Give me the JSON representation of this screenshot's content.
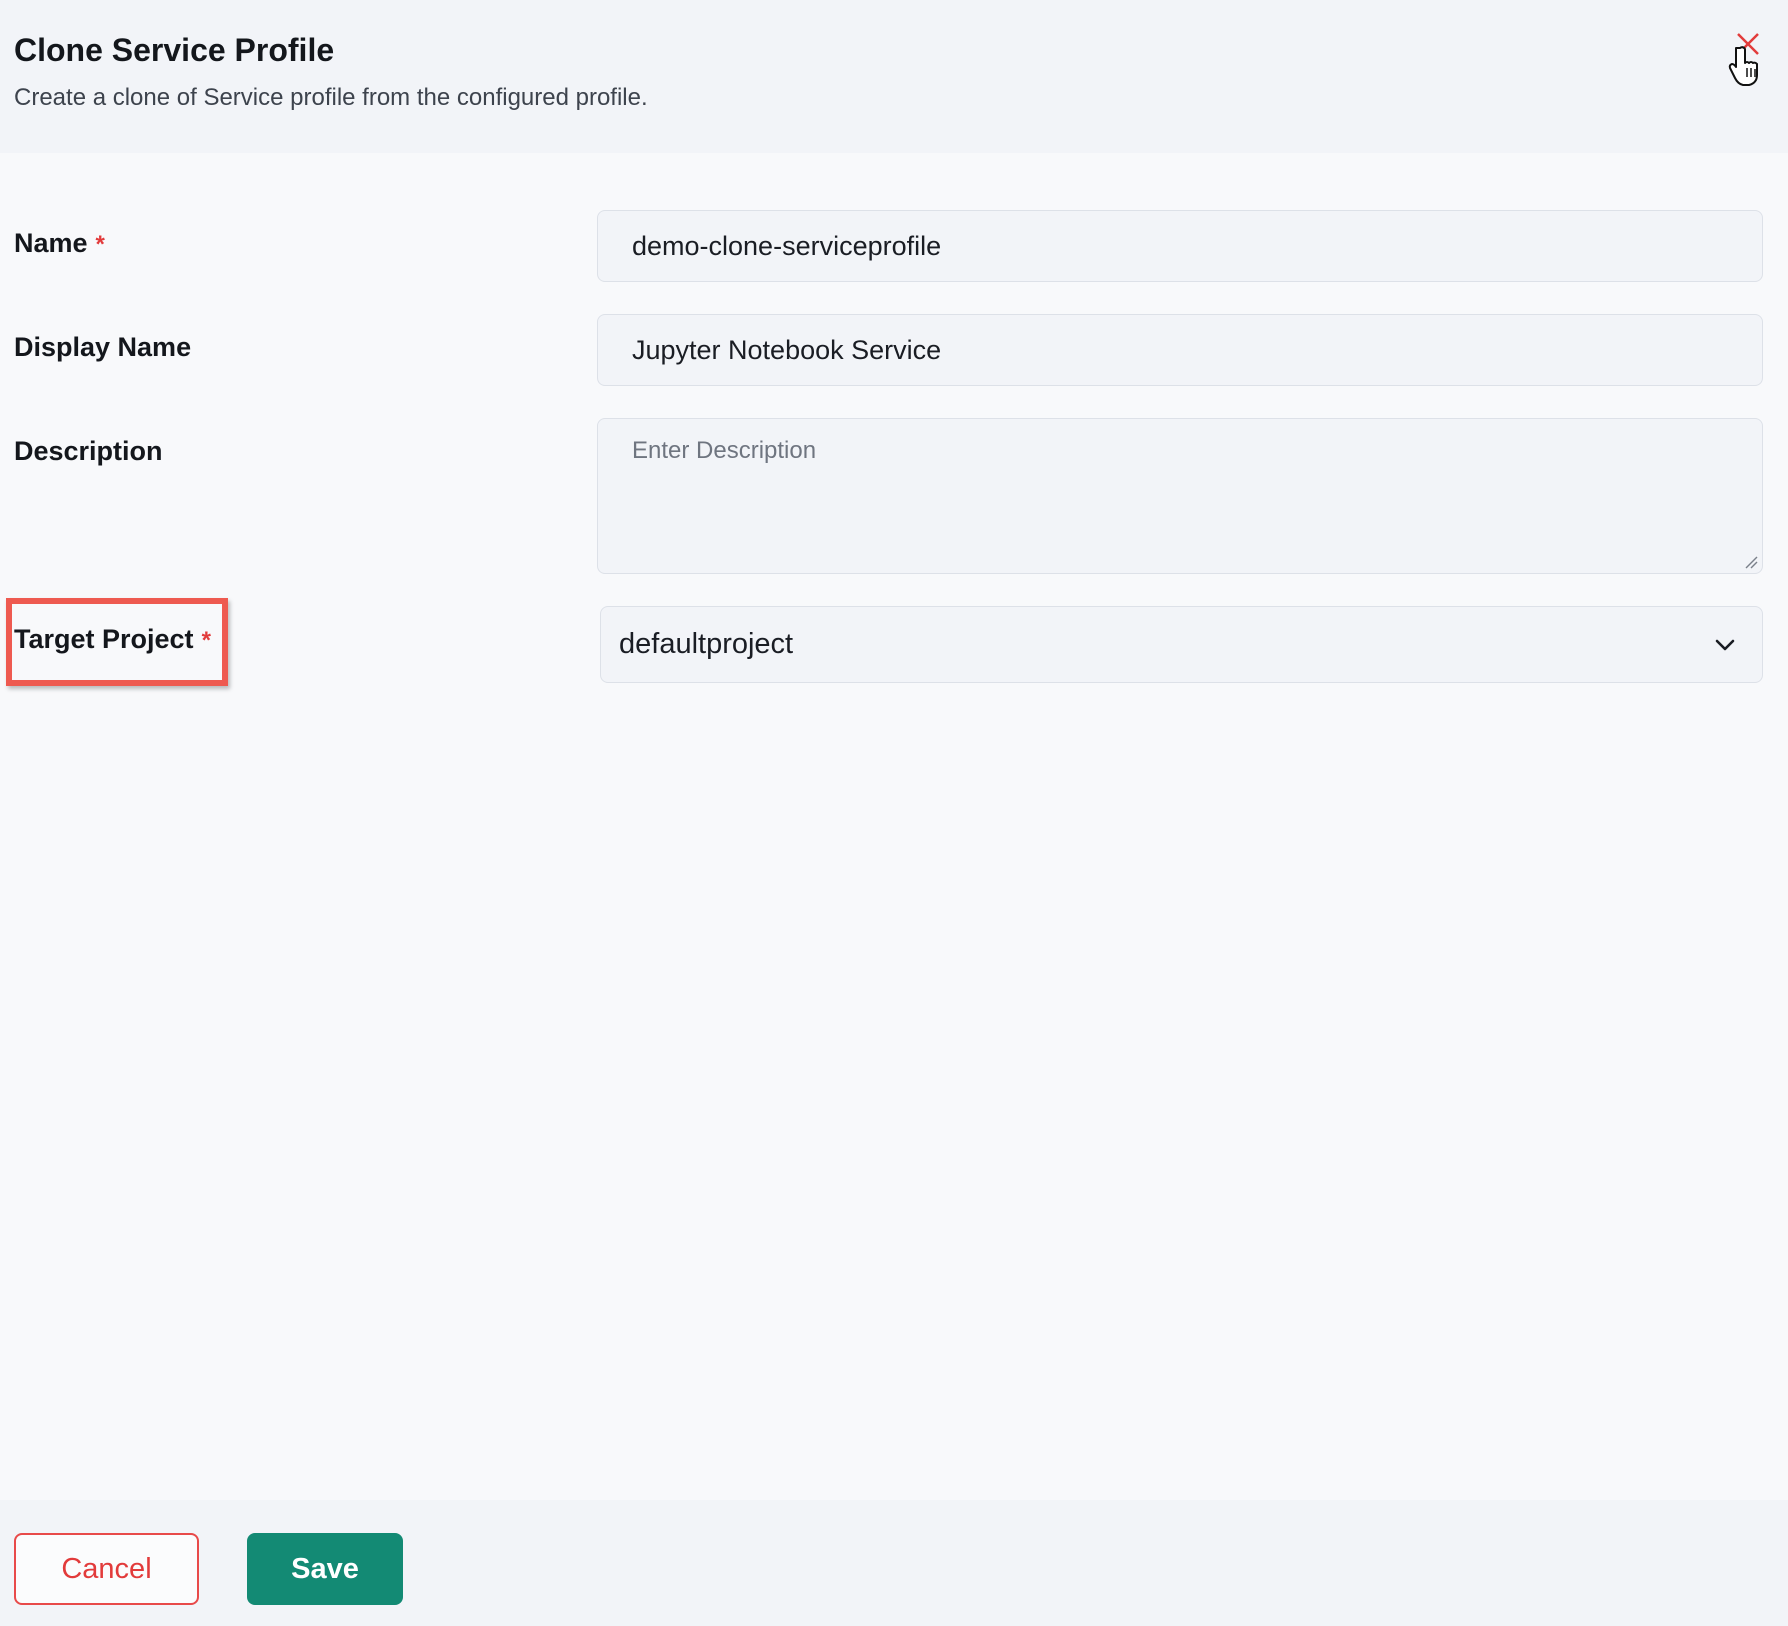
{
  "dialog": {
    "title": "Clone Service Profile",
    "subtitle": "Create a clone of Service profile from the configured profile."
  },
  "form": {
    "name": {
      "label": "Name",
      "required_mark": "*",
      "value": "demo-clone-serviceprofile"
    },
    "display_name": {
      "label": "Display Name",
      "value": "Jupyter Notebook Service"
    },
    "description": {
      "label": "Description",
      "placeholder": "Enter Description",
      "value": ""
    },
    "target_project": {
      "label": "Target Project",
      "required_mark": "*",
      "selected": "defaultproject"
    }
  },
  "footer": {
    "cancel_label": "Cancel",
    "save_label": "Save"
  },
  "colors": {
    "accent": "#138a74",
    "danger": "#e23b3b",
    "highlight": "#ee5a50"
  },
  "icons": {
    "close": "close-icon",
    "chevron": "chevron-down-icon",
    "cursor": "hand-pointer-icon"
  }
}
